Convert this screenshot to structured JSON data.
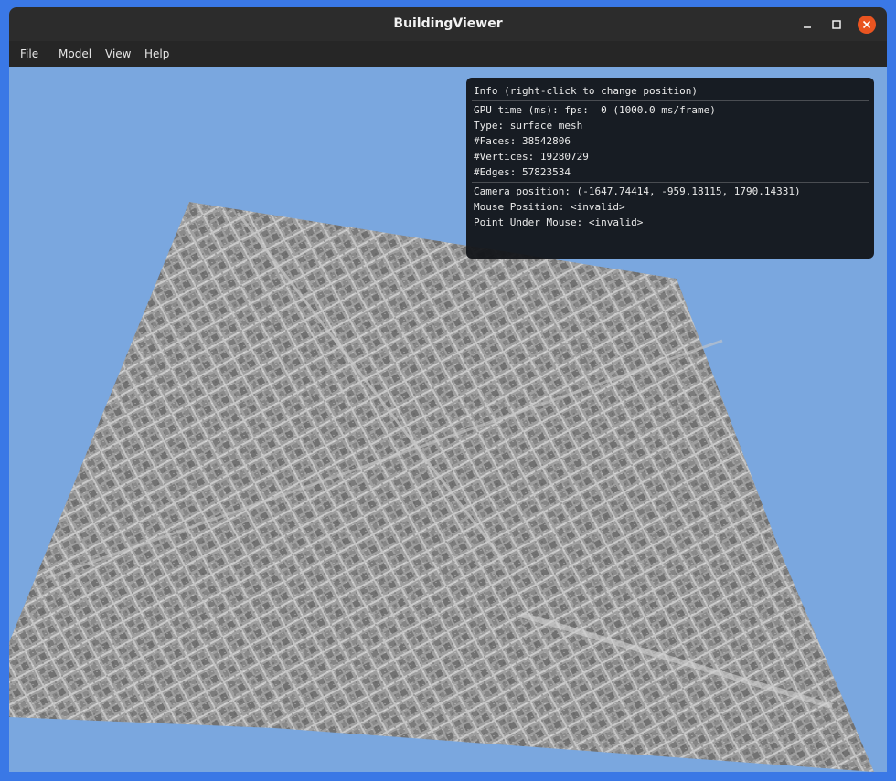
{
  "window": {
    "title": "BuildingViewer"
  },
  "menu": {
    "items": [
      "File",
      "Model",
      "View",
      "Help"
    ]
  },
  "info_panel": {
    "header": "Info (right-click to change position)",
    "gpu": "GPU time (ms): fps:  0 (1000.0 ms/frame)",
    "type": "Type: surface mesh",
    "faces": "#Faces: 38542806",
    "vertices": "#Vertices: 19280729",
    "edges": "#Edges: 57823534",
    "camera": "Camera position: (-1647.74414, -959.18115, 1790.14331)",
    "mouse": "Mouse Position: <invalid>",
    "point": "Point Under Mouse: <invalid>"
  },
  "colors": {
    "background": "#7aa7df",
    "mesh": "#a8a8a8",
    "close_button": "#e95420",
    "desktop": "#3a78e6"
  }
}
